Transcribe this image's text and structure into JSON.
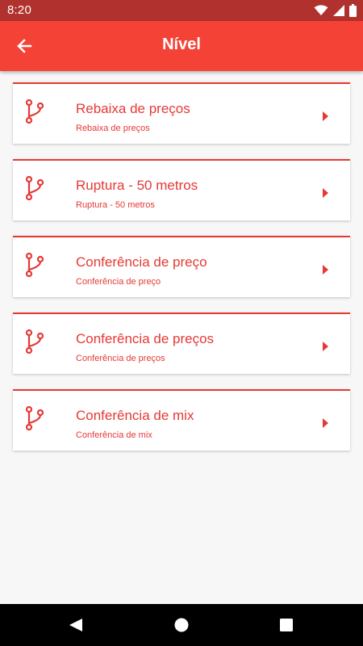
{
  "status_bar": {
    "time": "8:20",
    "icons": [
      "wifi-icon",
      "signal-icon",
      "battery-icon"
    ]
  },
  "app_bar": {
    "title": "Nível",
    "back_icon": "arrow-back-icon"
  },
  "list": {
    "items": [
      {
        "title": "Rebaixa de preços",
        "subtitle": "Rebaixa de preços",
        "icon": "branch-icon"
      },
      {
        "title": "Ruptura - 50 metros",
        "subtitle": "Ruptura - 50 metros",
        "icon": "branch-icon"
      },
      {
        "title": "Conferência de preço",
        "subtitle": "Conferência de preço",
        "icon": "branch-icon"
      },
      {
        "title": "Conferência de preços",
        "subtitle": "Conferência de preços",
        "icon": "branch-icon"
      },
      {
        "title": "Conferência de mix",
        "subtitle": "Conferência de mix",
        "icon": "branch-icon"
      }
    ]
  },
  "nav_bar": {
    "icons": [
      "back-triangle-icon",
      "home-circle-icon",
      "recents-square-icon"
    ]
  },
  "colors": {
    "status_bar": "#b0312d",
    "app_bar": "#f44336",
    "accent": "#e53935",
    "background": "#f7f7f7"
  }
}
